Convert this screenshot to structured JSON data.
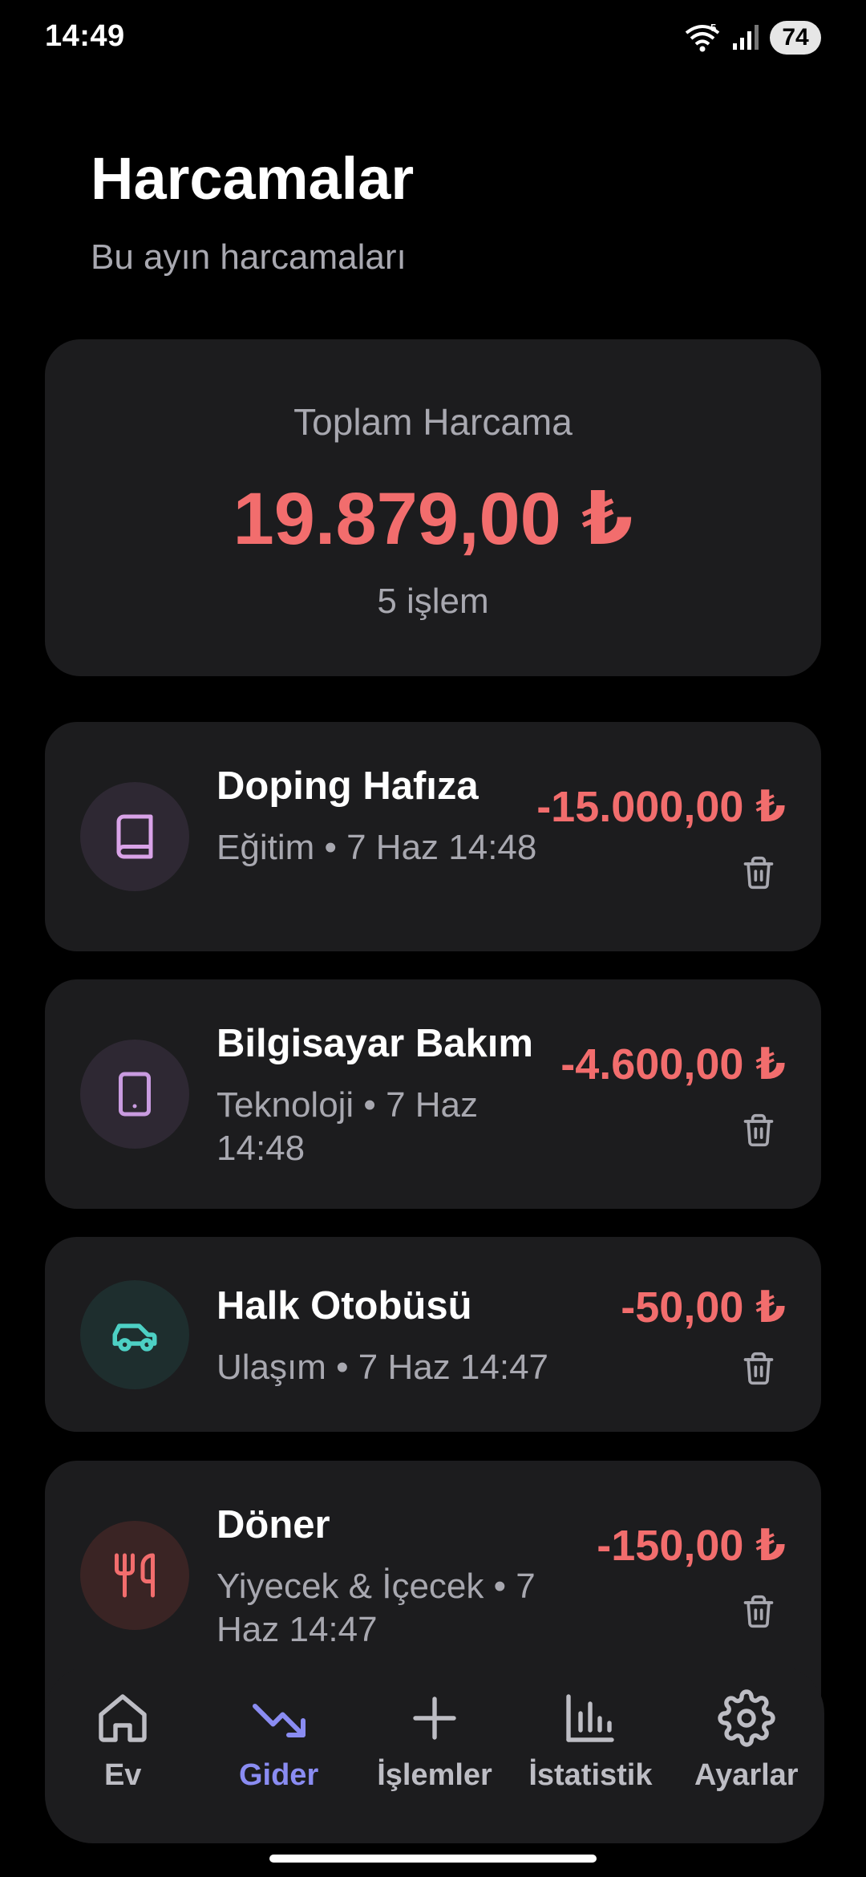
{
  "status_bar": {
    "time": "14:49",
    "wifi_badge": "5",
    "battery": "74"
  },
  "header": {
    "title": "Harcamalar",
    "subtitle": "Bu ayın harcamaları"
  },
  "summary": {
    "label": "Toplam Harcama",
    "amount": "19.879,00 ₺",
    "count": "5 işlem"
  },
  "transactions": [
    {
      "title": "Doping Hafıza",
      "meta": "Eğitim • 7 Haz 14:48",
      "amount": "-15.000,00 ₺",
      "icon": "book-icon",
      "icon_color": "#d9a3e8",
      "icon_bg": "#2e2833"
    },
    {
      "title": "Bilgisayar Bakım",
      "meta": "Teknoloji • 7 Haz 14:48",
      "amount": "-4.600,00 ₺",
      "icon": "tablet-icon",
      "icon_color": "#c99be0",
      "icon_bg": "#2e2833"
    },
    {
      "title": "Halk Otobüsü",
      "meta": "Ulaşım • 7 Haz 14:47",
      "amount": "-50,00 ₺",
      "icon": "car-icon",
      "icon_color": "#4dd0c4",
      "icon_bg": "#1e2e2e"
    },
    {
      "title": "Döner",
      "meta": "Yiyecek & İçecek • 7 Haz 14:47",
      "amount": "-150,00 ₺",
      "icon": "utensils-icon",
      "icon_color": "#f26d6d",
      "icon_bg": "#3a2424"
    }
  ],
  "nav": {
    "items": [
      {
        "label": "Ev",
        "icon": "home-icon"
      },
      {
        "label": "Gider",
        "icon": "trending-down-icon",
        "active": true
      },
      {
        "label": "İşlemler",
        "icon": "plus-icon"
      },
      {
        "label": "İstatistik",
        "icon": "bar-chart-icon"
      },
      {
        "label": "Ayarlar",
        "icon": "gear-icon"
      }
    ]
  },
  "colors": {
    "accent": "#8a8cf2",
    "expense": "#f26d6d",
    "card": "#1c1c1e",
    "muted": "#a8a8b0"
  }
}
